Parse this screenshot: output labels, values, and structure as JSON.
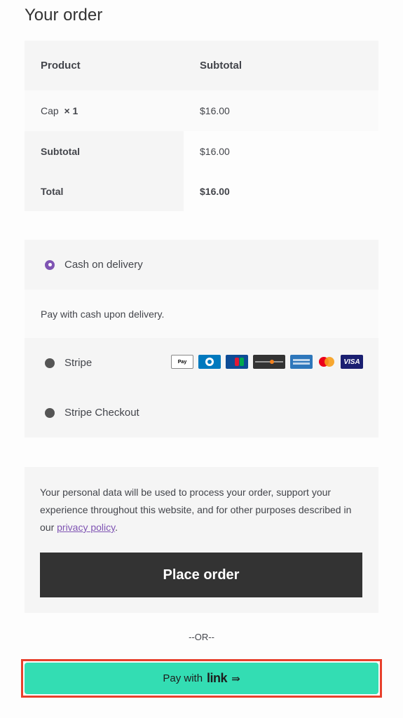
{
  "title": "Your order",
  "table": {
    "head": {
      "product": "Product",
      "subtotal": "Subtotal"
    },
    "item": {
      "name": "Cap",
      "qty": "× 1",
      "price": "$16.00"
    },
    "subtotal": {
      "label": "Subtotal",
      "value": "$16.00"
    },
    "total": {
      "label": "Total",
      "value": "$16.00"
    }
  },
  "payment": {
    "cod_label": "Cash on delivery",
    "cod_desc": "Pay with cash upon delivery.",
    "stripe_label": "Stripe",
    "stripe_checkout_label": "Stripe Checkout",
    "cards": [
      "Pay",
      "VISA"
    ]
  },
  "privacy": {
    "text": "Your personal data will be used to process your order, support your experience throughout this website, and for other purposes described in our ",
    "link": "privacy policy",
    "end": "."
  },
  "place_order": "Place order",
  "or": "--OR--",
  "link_pay": {
    "prefix": "Pay with",
    "logo": "link",
    "arrow": "⇛"
  },
  "colors": {
    "accent": "#7f54b3",
    "link_green": "#33ddb3",
    "highlight": "#e8402c"
  }
}
